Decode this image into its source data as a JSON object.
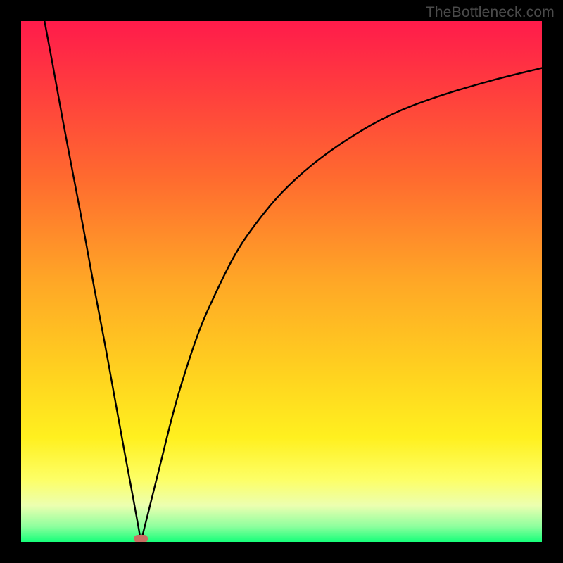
{
  "watermark": "TheBottleneck.com",
  "chart_data": {
    "type": "line",
    "title": "",
    "xlabel": "",
    "ylabel": "",
    "xlim": [
      0,
      100
    ],
    "ylim": [
      0,
      100
    ],
    "minimum_marker": {
      "x": 23,
      "y": 0,
      "color": "#c96e62"
    },
    "gradient_stops": [
      {
        "offset": 0,
        "color": "#ff1b4b"
      },
      {
        "offset": 0.12,
        "color": "#ff3a3f"
      },
      {
        "offset": 0.3,
        "color": "#ff6a2f"
      },
      {
        "offset": 0.5,
        "color": "#ffa726"
      },
      {
        "offset": 0.68,
        "color": "#ffd31f"
      },
      {
        "offset": 0.8,
        "color": "#fff01f"
      },
      {
        "offset": 0.88,
        "color": "#fdff66"
      },
      {
        "offset": 0.93,
        "color": "#ecffb0"
      },
      {
        "offset": 0.97,
        "color": "#8fff9e"
      },
      {
        "offset": 1.0,
        "color": "#17ff7a"
      }
    ],
    "series": [
      {
        "name": "left-branch",
        "x": [
          4.5,
          6,
          8,
          10,
          12,
          14,
          16,
          18,
          20,
          21.5,
          22.5,
          23
        ],
        "y": [
          100,
          92,
          81,
          70.5,
          60,
          49,
          38.5,
          27.5,
          16.5,
          8.5,
          3,
          0
        ]
      },
      {
        "name": "right-branch",
        "x": [
          23,
          24,
          25.5,
          27,
          29,
          31,
          34,
          37,
          41,
          45,
          50,
          56,
          63,
          71,
          80,
          90,
          100
        ],
        "y": [
          0,
          4,
          10,
          16,
          24,
          31,
          40,
          47,
          55,
          61,
          67,
          72.5,
          77.5,
          82,
          85.5,
          88.5,
          91
        ]
      }
    ]
  }
}
